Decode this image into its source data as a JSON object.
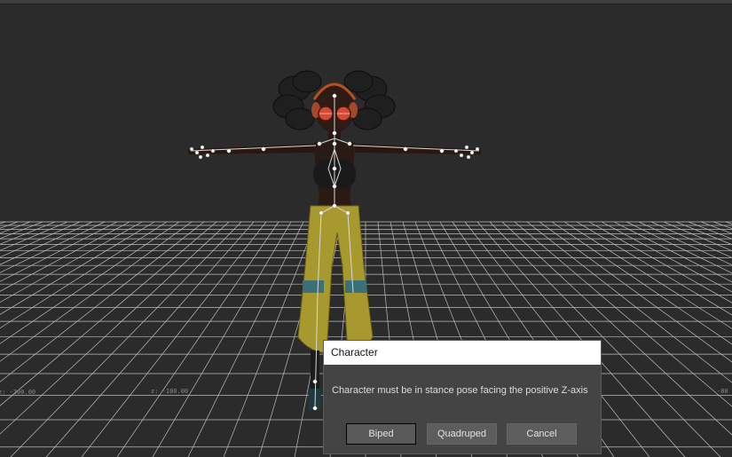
{
  "viewport": {
    "background": "#2b2b2b",
    "grid_color": "#bdbdbd",
    "grid_labels": [
      "z: -100.00",
      "z: -200.00",
      "-00"
    ]
  },
  "dialog": {
    "title": "Character",
    "message": "Character must be in stance pose facing the positive Z-axis",
    "buttons": {
      "biped": "Biped",
      "quadruped": "Quadruped",
      "cancel": "Cancel"
    }
  }
}
